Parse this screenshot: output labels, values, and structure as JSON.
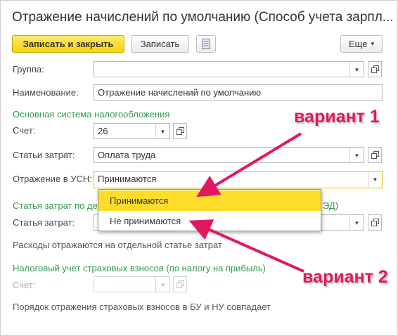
{
  "window": {
    "title": "Отражение начислений по умолчанию (Способ учета зарпл..."
  },
  "toolbar": {
    "save_close": "Записать и закрыть",
    "save": "Записать",
    "more": "Еще",
    "more_caret": "▾",
    "doc_icon": "document-icon"
  },
  "form": {
    "group_label": "Группа:",
    "group_value": "",
    "name_label": "Наименование:",
    "name_value": "Отражение начислений по умолчанию",
    "section_main": "Основная система налогообложения",
    "account_label": "Счет:",
    "account_value": "26",
    "costs_label": "Статьи затрат:",
    "costs_value": "Оплата труда",
    "usn_label": "Отражение в УСН:",
    "usn_value": "Принимаются",
    "section_costs_left": "Статья затрат по де",
    "section_costs_right": "ЭД)",
    "cost_item_label": "Статья затрат:",
    "note_separate": "Расходы отражаются на отдельной статье затрат",
    "section_tax": "Налоговый учет страховых взносов (по налогу на прибыль)",
    "tax_account_label": "Счет:",
    "note_same": "Порядок отражения страховых взносов в БУ и НУ совпадает"
  },
  "dropdown": {
    "options": [
      "Принимаются",
      "Не принимаются"
    ],
    "selected_index": 0
  },
  "annotations": {
    "variant1": "вариант 1",
    "variant2": "вариант 2",
    "color": "#e2185f"
  },
  "colors": {
    "accent_yellow": "#fddc2a",
    "section_green": "#2e9a49"
  }
}
